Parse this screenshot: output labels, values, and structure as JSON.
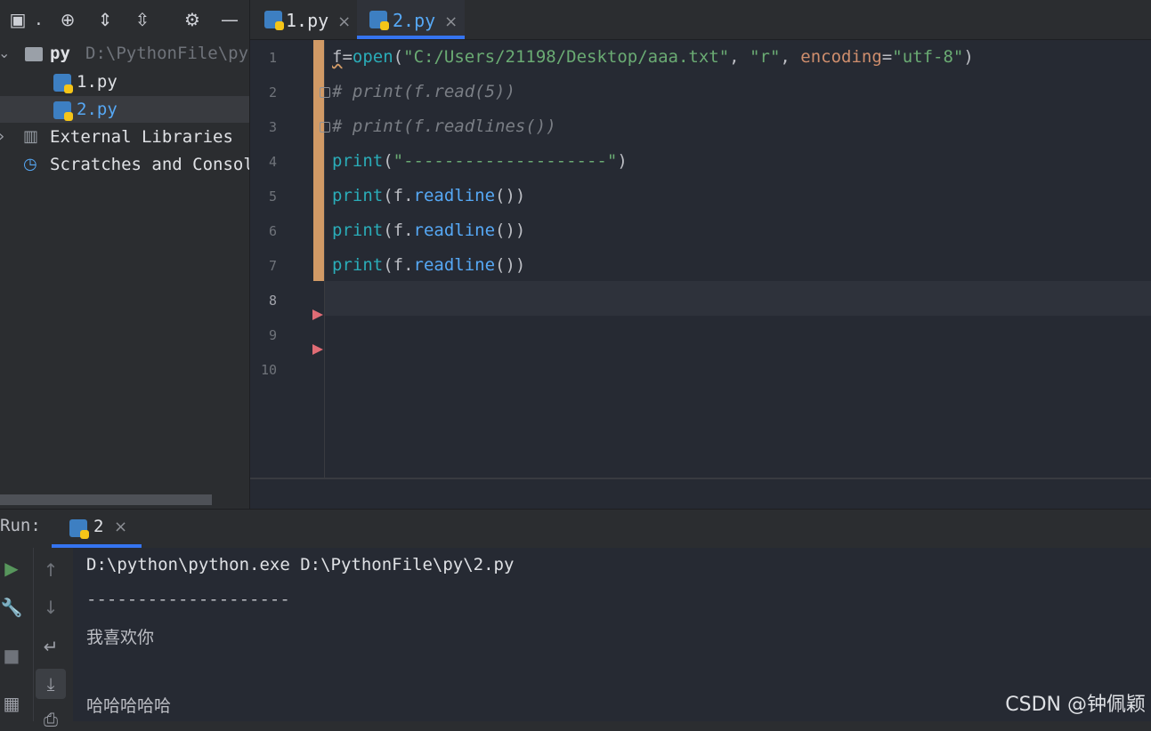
{
  "project": {
    "toolbar": {
      "title_abbrev": "."
    },
    "tree": [
      {
        "name": "py",
        "path": "D:\\PythonFile\\py"
      },
      {
        "name": "1.py"
      },
      {
        "name": "2.py"
      },
      {
        "name": "External Libraries"
      },
      {
        "name": "Scratches and Consoles"
      }
    ]
  },
  "tabs": [
    {
      "label": "1.py",
      "active": false
    },
    {
      "label": "2.py",
      "active": true
    }
  ],
  "editor": {
    "line_numbers": [
      "1",
      "2",
      "3",
      "4",
      "5",
      "6",
      "7",
      "8",
      "9",
      "10"
    ],
    "code": {
      "l1": {
        "var": "f",
        "eq": "=",
        "fn": "open",
        "p1": "(",
        "arg1": "\"C:/Users/21198/Desktop/aaa.txt\"",
        "c1": ", ",
        "arg2": "\"r\"",
        "c2": ", ",
        "kw": "encoding",
        "eq2": "=",
        "arg3": "\"utf-8\"",
        "p2": ")"
      },
      "l2": "# print(f.read(5))",
      "l3": "# print(f.readlines())",
      "l4": {
        "fn": "print",
        "p1": "(",
        "arg": "\"--------------------\"",
        "p2": ")"
      },
      "l5": {
        "fn": "print",
        "p1": "(f.",
        "method": "readline",
        "p2": "())"
      },
      "l6": {
        "fn": "print",
        "p1": "(f.",
        "method": "readline",
        "p2": "())"
      },
      "l7": {
        "fn": "print",
        "p1": "(f.",
        "method": "readline",
        "p2": "())"
      }
    }
  },
  "run": {
    "title": "Run:",
    "tab_label": "2",
    "output": [
      "D:\\python\\python.exe D:\\PythonFile\\py\\2.py",
      "--------------------",
      "我喜欢你",
      "",
      "哈哈哈哈哈"
    ]
  },
  "watermark": "CSDN @钟佩颖",
  "colors": {
    "accent": "#3574f0",
    "change_bar": "#d19a66",
    "breakpoint": "#e06c75"
  }
}
